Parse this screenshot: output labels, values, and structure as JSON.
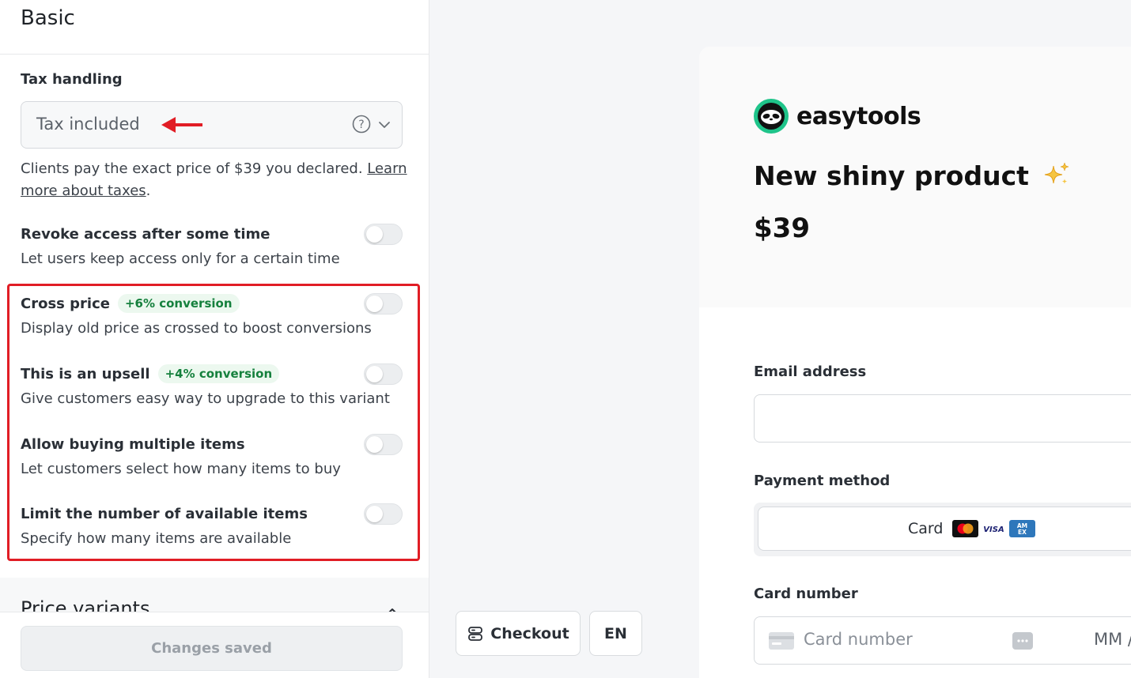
{
  "left_panel": {
    "section_title": "Basic",
    "tax": {
      "label": "Tax handling",
      "value": "Tax included",
      "help_prefix": "Clients pay the exact price of $39 you declared. ",
      "help_link": "Learn more about taxes",
      "help_suffix": "."
    },
    "options": [
      {
        "title": "Revoke access after some time",
        "badge": "",
        "desc": "Let users keep access only for a certain time",
        "enabled": false
      },
      {
        "title": "Cross price",
        "badge": "+6% conversion",
        "desc": "Display old price as crossed to boost conversions",
        "enabled": false
      },
      {
        "title": "This is an upsell",
        "badge": "+4% conversion",
        "desc": "Give customers easy way to upgrade to this variant",
        "enabled": false
      },
      {
        "title": "Allow buying multiple items",
        "badge": "",
        "desc": "Let customers select how many items to buy",
        "enabled": false
      },
      {
        "title": "Limit the number of available items",
        "badge": "",
        "desc": "Specify how many items are available",
        "enabled": false
      }
    ],
    "price_variants_title": "Price variants",
    "saved_button": "Changes saved"
  },
  "preview_controls": {
    "checkout_label": "Checkout",
    "language_label": "EN"
  },
  "preview": {
    "brand": "easytools",
    "product_title": "New shiny product",
    "price": "$39",
    "email_label": "Email address",
    "payment_label": "Payment method",
    "card_option": "Card",
    "card_number_label": "Card number",
    "card_number_placeholder": "Card number",
    "expiry_placeholder": "MM /"
  },
  "colors": {
    "highlight": "#e11d25",
    "badge_text": "#15803d",
    "badge_bg": "#ecf8ef",
    "brand_green": "#1fc48a"
  }
}
